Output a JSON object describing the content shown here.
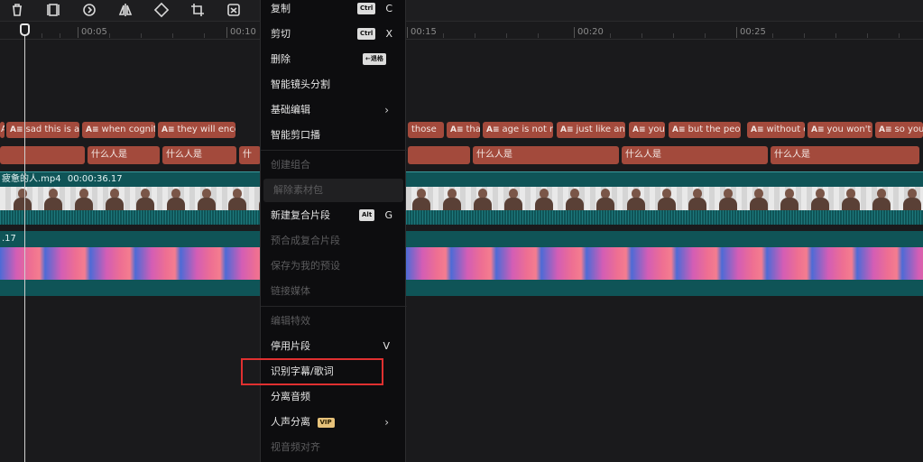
{
  "ruler": {
    "ticks": [
      "00:05",
      "00:10",
      "00:15",
      "00:20",
      "00:25"
    ]
  },
  "subtitle_track": {
    "clips": [
      {
        "label": "A"
      },
      {
        "label": "sad this is a"
      },
      {
        "label": "when cognit"
      },
      {
        "label": "they will enco"
      },
      {
        "label": "those"
      },
      {
        "label": "tha"
      },
      {
        "label": "age is not n"
      },
      {
        "label": "just like an"
      },
      {
        "label": "you"
      },
      {
        "label": "but the peop"
      },
      {
        "label": "without c"
      },
      {
        "label": "you won't"
      },
      {
        "label": "so you"
      }
    ],
    "ai_prefix": "A≡"
  },
  "text_track": {
    "clips": [
      "什么人是",
      "什么人是",
      "什",
      "什么人是",
      "什么人是",
      "什么人是"
    ]
  },
  "video_track": {
    "name": "疲惫的人.mp4",
    "duration": "00:00:36.17"
  },
  "effect_track": {
    "duration": ".17"
  },
  "menu": {
    "copy": {
      "label": "复制",
      "key": "Ctrl",
      "char": "C"
    },
    "cut": {
      "label": "剪切",
      "key": "Ctrl",
      "char": "X"
    },
    "delete": {
      "label": "删除",
      "key": "←退格"
    },
    "smart_split": {
      "label": "智能镜头分割"
    },
    "basic_edit": {
      "label": "基础编辑"
    },
    "smart_cut": {
      "label": "智能剪口播"
    },
    "create_group": {
      "label": "创建组合"
    },
    "release_material": {
      "label": "解除素材包"
    },
    "new_compound": {
      "label": "新建复合片段",
      "key": "Alt",
      "char": "G"
    },
    "pre_compound": {
      "label": "预合成复合片段"
    },
    "save_preset": {
      "label": "保存为我的预设"
    },
    "link_media": {
      "label": "链接媒体"
    },
    "edit_effect": {
      "label": "编辑特效"
    },
    "disable_clip": {
      "label": "停用片段",
      "char": "V"
    },
    "recognize_subtitle": {
      "label": "识别字幕/歌词"
    },
    "separate_audio": {
      "label": "分离音频"
    },
    "voice_separation": {
      "label": "人声分离",
      "badge": "VIP"
    },
    "av_align": {
      "label": "视音频对齐"
    }
  },
  "colors": {
    "highlight": "#e03030",
    "subtitle_clip": "#a34a3c",
    "video_track": "#0f5457"
  }
}
